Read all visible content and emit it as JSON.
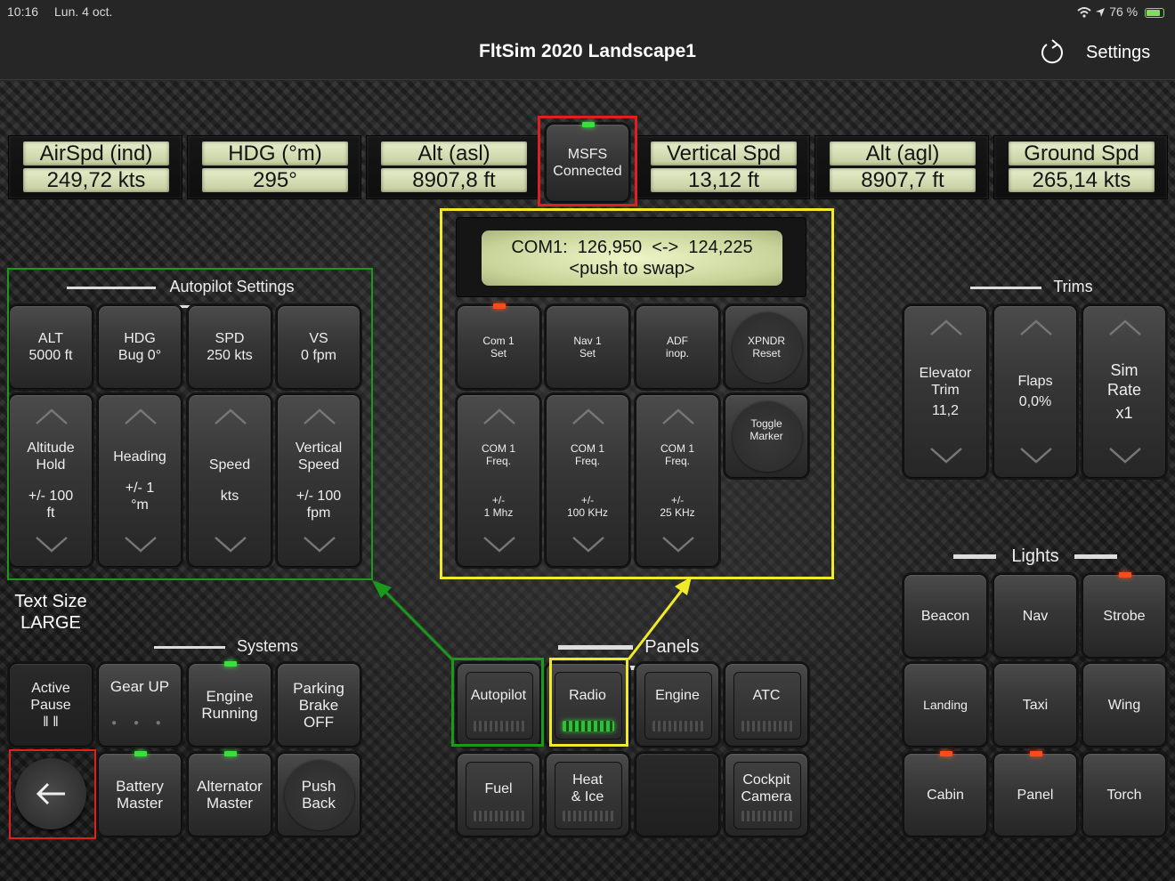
{
  "status_bar": {
    "time": "10:16",
    "date": "Lun. 4 oct.",
    "battery": "76 %"
  },
  "navbar": {
    "title": "FltSim 2020 Landscape1",
    "settings_label": "Settings"
  },
  "gauges": [
    {
      "label": "AirSpd (ind)",
      "value": "249,72 kts"
    },
    {
      "label": "HDG (°m)",
      "value": "295°"
    },
    {
      "label": "Alt (asl)",
      "value": "8907,8 ft"
    },
    {
      "label": "Vertical Spd",
      "value": "13,12 ft"
    },
    {
      "label": "Alt (agl)",
      "value": "8907,7 ft"
    },
    {
      "label": "Ground Spd",
      "value": "265,14 kts"
    }
  ],
  "connection": {
    "line1": "MSFS",
    "line2": "Connected"
  },
  "autopilot": {
    "title": "Autopilot Settings",
    "settings": [
      {
        "label": "ALT\n5000 ft"
      },
      {
        "label": "HDG\nBug 0°"
      },
      {
        "label": "SPD\n250 kts"
      },
      {
        "label": "VS\n0 fpm"
      }
    ],
    "adjusters": [
      {
        "name": "Altitude\nHold",
        "step": "+/- 100\nft"
      },
      {
        "name": "Heading",
        "step": "+/- 1\n°m"
      },
      {
        "name": "Speed",
        "step": "kts"
      },
      {
        "name": "Vertical\nSpeed",
        "step": "+/- 100\nfpm"
      }
    ]
  },
  "radio": {
    "display_line1": "COM1:  126,950  <->  124,225",
    "display_line2": "<push to swap>",
    "top_buttons": [
      "Com 1\nSet",
      "Nav 1\nSet",
      "ADF\ninop.",
      "XPNDR\nReset"
    ],
    "freq_buttons": [
      {
        "name": "COM 1\nFreq.",
        "step": "+/-\n1 Mhz"
      },
      {
        "name": "COM 1\nFreq.",
        "step": "+/-\n100 KHz"
      },
      {
        "name": "COM 1\nFreq.",
        "step": "+/-\n25 KHz"
      }
    ],
    "toggle_marker": "Toggle\nMarker"
  },
  "trims": {
    "title": "Trims",
    "items": [
      {
        "label": "Elevator\nTrim",
        "value": "11,2"
      },
      {
        "label": "Flaps",
        "value": "0,0%"
      },
      {
        "label": "Sim\nRate",
        "value": "x1"
      }
    ]
  },
  "lights": {
    "title": "Lights",
    "items": [
      "Beacon",
      "Nav",
      "Strobe",
      "Landing",
      "Taxi",
      "Wing",
      "Cabin",
      "Panel",
      "Torch"
    ]
  },
  "text_size": "Text Size\nLARGE",
  "systems": {
    "title": "Systems",
    "active_pause": "Active\nPause\n‖ ‖",
    "items": [
      "Gear UP",
      "Engine\nRunning",
      "Parking\nBrake\nOFF",
      "Battery\nMaster",
      "Alternator\nMaster",
      "Push\nBack"
    ]
  },
  "panels": {
    "title": "Panels",
    "items": [
      "Autopilot",
      "Radio",
      "Engine",
      "ATC",
      "Fuel",
      "Heat\n& Ice",
      "Cockpit\nCamera"
    ]
  },
  "colors": {
    "highlight_red": "#e0201e",
    "highlight_yellow": "#f1ea2b",
    "highlight_green": "#1a9a1a",
    "led_green": "#37e03b",
    "led_red": "#ff4a1a",
    "lcd": "#d8e0b5"
  },
  "icons": {
    "refresh": "refresh-icon",
    "back": "arrow-left-icon",
    "wifi": "wifi-icon",
    "location": "location-arrow-icon",
    "battery": "battery-icon"
  }
}
